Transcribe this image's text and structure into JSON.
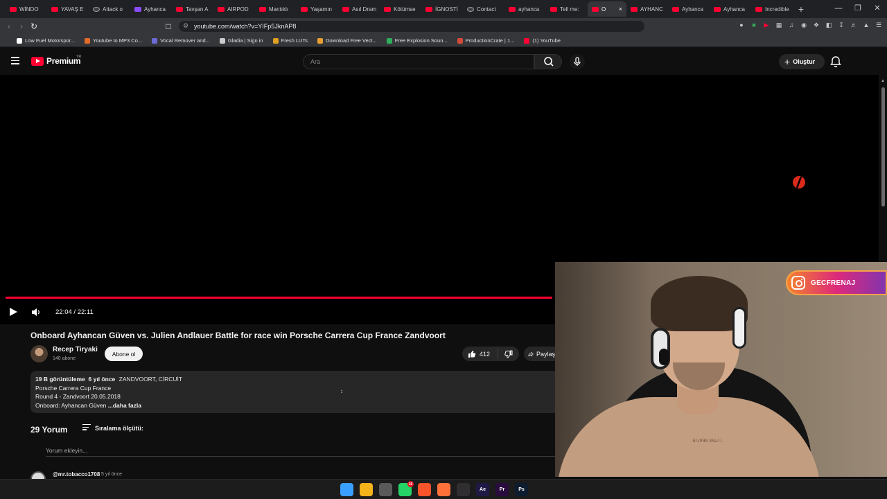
{
  "browser": {
    "tabs": [
      {
        "label": "WİNDO",
        "icon": "youtube-icon"
      },
      {
        "label": "YAVAŞ E",
        "icon": "youtube-icon"
      },
      {
        "label": "Attack o",
        "icon": "globe-icon"
      },
      {
        "label": "Ayhanca",
        "icon": "purple-icon"
      },
      {
        "label": "Tavşan A",
        "icon": "youtube-icon"
      },
      {
        "label": "AIRPOD",
        "icon": "youtube-icon"
      },
      {
        "label": "Mantıklı",
        "icon": "youtube-icon"
      },
      {
        "label": "Yaşamın",
        "icon": "youtube-icon"
      },
      {
        "label": "Asıl Dram",
        "icon": "youtube-icon"
      },
      {
        "label": "Kötümse",
        "icon": "youtube-icon"
      },
      {
        "label": "İGNOSTİ",
        "icon": "youtube-icon"
      },
      {
        "label": "Contact",
        "icon": "globe-icon"
      },
      {
        "label": "ayhanca",
        "icon": "youtube-icon"
      },
      {
        "label": "Tell me:",
        "icon": "youtube-icon"
      },
      {
        "label": "O",
        "icon": "youtube-icon",
        "active": true
      },
      {
        "label": "AYHANC",
        "icon": "youtube-icon"
      },
      {
        "label": "Ayhanca",
        "icon": "youtube-icon"
      },
      {
        "label": "Ayhanca",
        "icon": "youtube-icon"
      },
      {
        "label": "Incredible",
        "icon": "youtube-icon"
      }
    ],
    "new_tab": "+",
    "url": "youtube.com/watch?v=YIFp5JknAP8",
    "bookmarks": [
      {
        "label": "Low Fuel Motorspor..."
      },
      {
        "label": "Youtube to MP3 Co..."
      },
      {
        "label": "Vocal Remover and..."
      },
      {
        "label": "Gladia | Sign in"
      },
      {
        "label": "Fresh LUTs"
      },
      {
        "label": "Download Free Vect..."
      },
      {
        "label": "Free Explosion Soun..."
      },
      {
        "label": "ProductionCrate | 1..."
      },
      {
        "label": "(1) YouTube"
      }
    ]
  },
  "youtube": {
    "logo_text": "Premium",
    "region": "TR",
    "search_placeholder": "Ara",
    "create_label": "Oluştur",
    "player": {
      "time": "22:04 / 22:11",
      "progress": 0.995
    },
    "video": {
      "title": "Onboard Ayhancan Güven vs. Julien Andlauer Battle for race win Porsche Carrera Cup France Zandvoort",
      "channel": "Recep Tiryaki",
      "subscribers": "140 abone",
      "subscribe_label": "Abone ol",
      "likes": "412",
      "share_label": "Paylaş",
      "views": "19 B görüntüleme",
      "age": "6 yıl önce",
      "tags": "ZANDVOORT, CİRCUİT",
      "desc_lines": [
        "Porsche Carrera Cup France",
        "Round 4 - Zandvoort 20.05.2018"
      ],
      "desc_last": "Onboard: Ayhancan Güven",
      "more_label": "...daha fazla"
    },
    "comments": {
      "count_label": "29 Yorum",
      "sort_label": "Sıralama ölçütü:",
      "input_placeholder": "Yorum ekleyin...",
      "first_user": "@mr.tobacco1708",
      "first_time": "5 yıl önce"
    }
  },
  "overlay": {
    "instagram_handle": "GECFRENAJ",
    "shirt_text": "Ǝ┴ɹ∀ƎS SSǝ┴┴"
  },
  "taskbar": {
    "apps": [
      {
        "name": "windows-start-icon",
        "color": "#3aa0ff",
        "label": ""
      },
      {
        "name": "file-explorer-icon",
        "color": "#f2b31b",
        "label": ""
      },
      {
        "name": "snipping-tool-icon",
        "color": "#5a5a5a",
        "label": ""
      },
      {
        "name": "whatsapp-icon",
        "color": "#25d366",
        "label": "",
        "badge": "15"
      },
      {
        "name": "brave-browser-icon",
        "color": "#fb542b",
        "label": ""
      },
      {
        "name": "firefox-icon",
        "color": "#ff7139",
        "label": ""
      },
      {
        "name": "obs-icon",
        "color": "#302e31",
        "label": ""
      },
      {
        "name": "after-effects-icon",
        "color": "#1f1a45",
        "label": "Ae"
      },
      {
        "name": "premiere-pro-icon",
        "color": "#2a0b3d",
        "label": "Pr"
      },
      {
        "name": "photoshop-icon",
        "color": "#0d1c2f",
        "label": "Ps"
      },
      {
        "name": "media-player-icon",
        "color": "#1c1c1c",
        "label": ""
      }
    ]
  },
  "colors": {
    "youtube_red": "#ff0033",
    "background": "#0f0f0f",
    "chip": "#272727",
    "instagram_gradient_start": "#f58529",
    "instagram_gradient_end": "#8134af"
  }
}
